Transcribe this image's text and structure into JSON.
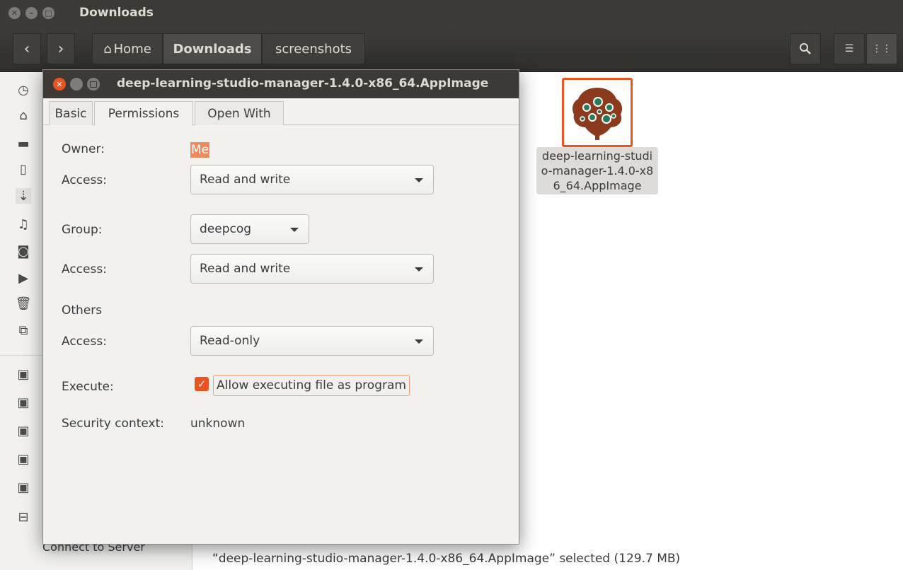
{
  "window": {
    "title": "Downloads"
  },
  "header": {
    "back_icon": "back-icon",
    "forward_icon": "forward-icon",
    "breadcrumbs": [
      "Home",
      "Downloads",
      "screenshots"
    ],
    "search_icon": "search-icon",
    "list_view_icon": "list-view-icon",
    "grid_view_icon": "grid-view-icon"
  },
  "sidebar": {
    "visible_label": "Connect to Server"
  },
  "file": {
    "name": "deep-learning-studio-manager-1.4.0-x86_64.AppImage",
    "colors": {
      "selection_border": "#e95420",
      "icon_brown": "#8b3a1e",
      "icon_green": "#2a7a5a"
    }
  },
  "status": {
    "text": "“deep-learning-studio-manager-1.4.0-x86_64.AppImage” selected  (129.7 MB)"
  },
  "dialog": {
    "title": "deep-learning-studio-manager-1.4.0-x86_64.AppImage",
    "tabs": [
      "Basic",
      "Permissions",
      "Open With"
    ],
    "active_tab": "Permissions",
    "owner_label": "Owner:",
    "owner_value": "Me",
    "owner_access_label": "Access:",
    "owner_access_value": "Read and write",
    "group_label": "Group:",
    "group_value": "deepcog",
    "group_access_label": "Access:",
    "group_access_value": "Read and write",
    "others_label": "Others",
    "others_access_label": "Access:",
    "others_access_value": "Read-only",
    "execute_label": "Execute:",
    "execute_checkbox_label": "Allow executing file as program",
    "execute_checked": true,
    "security_label": "Security context:",
    "security_value": "unknown"
  },
  "accent_color": "#e95420"
}
